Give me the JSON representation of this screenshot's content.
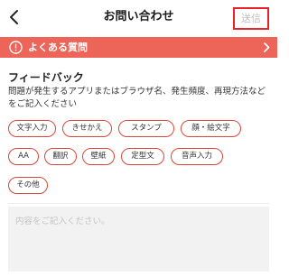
{
  "header": {
    "title": "お問い合わせ",
    "send_label": "送信"
  },
  "faq": {
    "label": "よくある質問"
  },
  "feedback": {
    "title": "フィードバック",
    "description": "問題が発生するアプリまたはブラウザ名、発生頻度、再現方法などをご記入ください",
    "chips": [
      "文字入力",
      "きせかえ",
      "スタンプ",
      "顔・絵文字",
      "AA",
      "翻訳",
      "壁紙",
      "定型文",
      "音声入力",
      "その他"
    ],
    "textarea_value": "",
    "textarea_placeholder": "内容をご記入ください。"
  },
  "colors": {
    "accent": "#ed6458",
    "send_highlight": "#e8232a",
    "chip_border": "#d9473b"
  },
  "icons": {
    "back": "chevron-left-icon",
    "faq": "exclamation-circle-icon",
    "faq_arrow": "chevron-right-icon"
  }
}
